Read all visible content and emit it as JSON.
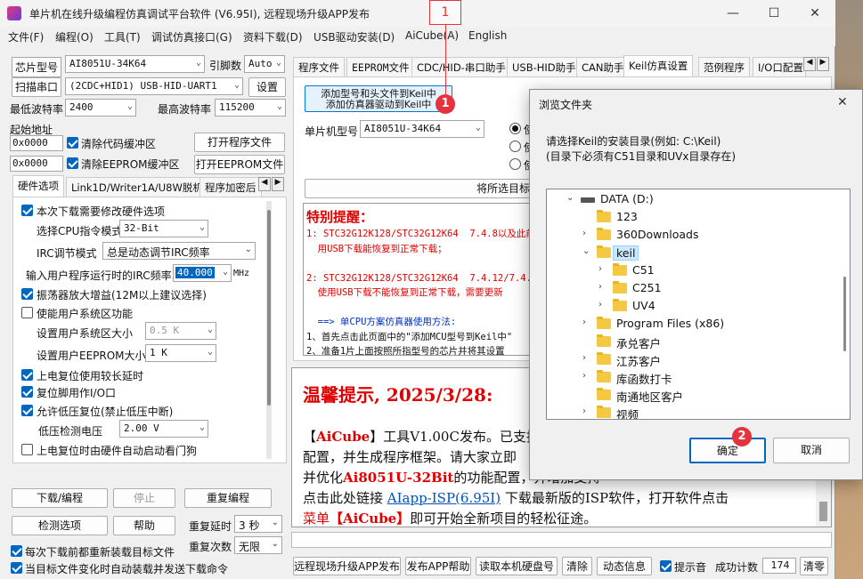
{
  "window": {
    "title": "单片机在线升级编程仿真调试平台软件 (V6.95I), 远程现场升级APP发布"
  },
  "menu": [
    "文件(F)",
    "编程(O)",
    "工具(T)",
    "调试仿真接口(G)",
    "资料下载(D)",
    "USB驱动安装(D)",
    "AiCube(A)",
    "English"
  ],
  "left": {
    "chip_label": "芯片型号",
    "chip_value": "AI8051U-34K64",
    "pins_label": "引脚数",
    "pins_value": "Auto",
    "scan_label": "扫描串口",
    "port_value": "(2CDC+HID1) USB-HID-UART1",
    "settings_label": "设置",
    "minbaud_label": "最低波特率",
    "minbaud_value": "2400",
    "maxbaud_label": "最高波特率",
    "maxbaud_value": "115200",
    "start_label": "起始地址",
    "addr1": "0x0000",
    "clear_code": "清除代码缓冲区",
    "open_prog": "打开程序文件",
    "addr2": "0x0000",
    "clear_eeprom": "清除EEPROM缓冲区",
    "open_eeprom": "打开EEPROM文件",
    "tabs": [
      "硬件选项",
      "Link1D/Writer1A/U8W脱机",
      "程序加密后"
    ],
    "hw": {
      "modify": "本次下载需要修改硬件选项",
      "cpu_mode_label": "选择CPU指令模式",
      "cpu_mode_value": "32-Bit",
      "irc_mode_label": "IRC调节模式",
      "irc_mode_value": "总是动态调节IRC频率",
      "irc_freq_label": "输入用户程序运行时的IRC频率",
      "irc_freq_value": "40.000",
      "irc_unit": "MHz",
      "osc_gain": "振荡器放大增益(12M以上建议选择)",
      "sys_area": "使能用户系统区功能",
      "sys_size_label": "设置用户系统区大小",
      "sys_size_value": "0.5 K",
      "eeprom_size_label": "设置用户EEPROM大小",
      "eeprom_size_value": "1  K",
      "long_delay": "上电复位使用较长延时",
      "reset_io": "复位脚用作I/O口",
      "lvr": "允许低压复位(禁止低压中断)",
      "lvd_label": "低压检测电压",
      "lvd_value": "2.00 V",
      "wdt": "上电复位时由硬件自动启动看门狗"
    },
    "download_btn": "下载/编程",
    "stop_btn": "停止",
    "reprogram_btn": "重复编程",
    "check_btn": "检测选项",
    "help_btn": "帮助",
    "repeat_delay_label": "重复延时",
    "repeat_delay_value": "3 秒",
    "repeat_count_label": "重复次数",
    "repeat_count_value": "无限",
    "reload_each": "每次下载前都重新装载目标文件",
    "auto_reload": "当目标文件变化时自动装载并发送下载命令"
  },
  "right": {
    "tabs": [
      "程序文件",
      "EEPROM文件",
      "CDC/HID-串口助手",
      "USB-HID助手",
      "CAN助手",
      "Keil仿真设置",
      "范例程序",
      "I/O口配置"
    ],
    "btn_add_line1": "添加型号和头文件到Keil中",
    "btn_add_line2": "添加仿真器驱动到Keil中",
    "mcu_label": "单片机型号",
    "mcu_value": "AI8051U-34K64",
    "radio_labels": [
      "使",
      "使",
      "使"
    ],
    "wide_btn": "将所选目标",
    "notice_title": "特别提醒：",
    "notice_lines": [
      "1: STC32G12K128/STC32G12K64  7.4.8以及此前",
      "  用USB下载能恢复到正常下载；",
      "",
      "2: STC32G12K128/STC32G12K64  7.4.12/7.4.13",
      "  使用USB下载不能恢复到正常下载，需要更新",
      "",
      "  ==> 单CPU方案仿真器使用方法:",
      "1、首先点击此页面中的\"添加MCU型号到Keil中\"",
      "2、准备1片上面按照所指型号的芯片并将其设置"
    ],
    "tip_title": "温馨提示, 2025/3/28:",
    "tip_p1_a": "【",
    "tip_p1_aicube": "AiCube",
    "tip_p1_b": "】工具V1.00C发布。已支持",
    "tip_p1_line2": "配置，并生成程序框架。请大家立即",
    "tip_p1_line3a": "并优化",
    "tip_p1_line3b": "Ai8051U-32Bit",
    "tip_p1_line3c": "的功能配置，并增加支持",
    "tip_p1_line4a": "点击此处链接 ",
    "tip_p1_link": "AIapp-ISP(6.95I)",
    "tip_p1_line4b": " 下载最新版的ISP软件，打开软件点击",
    "tip_p1_line5a": "菜单",
    "tip_p1_line5b": "【AiCube】",
    "tip_p1_line5c": "即可开始全新项目的轻松征途。"
  },
  "bottom": {
    "btn1": "远程现场升级APP发布",
    "btn2": "发布APP帮助",
    "btn3": "读取本机硬盘号",
    "btn4": "清除",
    "btn5": "动态信息",
    "beep": "提示音",
    "success_label": "成功计数",
    "success_value": "174",
    "clear": "清零"
  },
  "dialog": {
    "title": "浏览文件夹",
    "instr1": "请选择Keil的安装目录(例如: C:\\Keil)",
    "instr2": "(目录下必须有C51目录和UVx目录存在)",
    "tree": [
      {
        "label": "DATA (D:)",
        "indent": 0,
        "exp": "v",
        "icon": "drive"
      },
      {
        "label": "123",
        "indent": 1,
        "exp": "",
        "icon": "folder"
      },
      {
        "label": "360Downloads",
        "indent": 1,
        "exp": ">",
        "icon": "folder"
      },
      {
        "label": "keil",
        "indent": 1,
        "exp": "v",
        "icon": "folder",
        "selected": true
      },
      {
        "label": "C51",
        "indent": 2,
        "exp": ">",
        "icon": "folder"
      },
      {
        "label": "C251",
        "indent": 2,
        "exp": ">",
        "icon": "folder"
      },
      {
        "label": "UV4",
        "indent": 2,
        "exp": ">",
        "icon": "folder"
      },
      {
        "label": "Program Files (x86)",
        "indent": 1,
        "exp": ">",
        "icon": "folder"
      },
      {
        "label": "承兑客户",
        "indent": 1,
        "exp": "",
        "icon": "folder"
      },
      {
        "label": "江苏客户",
        "indent": 1,
        "exp": ">",
        "icon": "folder"
      },
      {
        "label": "库函数打卡",
        "indent": 1,
        "exp": ">",
        "icon": "folder"
      },
      {
        "label": "南通地区客户",
        "indent": 1,
        "exp": "",
        "icon": "folder"
      },
      {
        "label": "视频",
        "indent": 1,
        "exp": ">",
        "icon": "folder"
      }
    ],
    "ok": "确定",
    "cancel": "取消"
  },
  "annotations": {
    "callout": "1",
    "badge1": "1",
    "badge2": "2"
  }
}
